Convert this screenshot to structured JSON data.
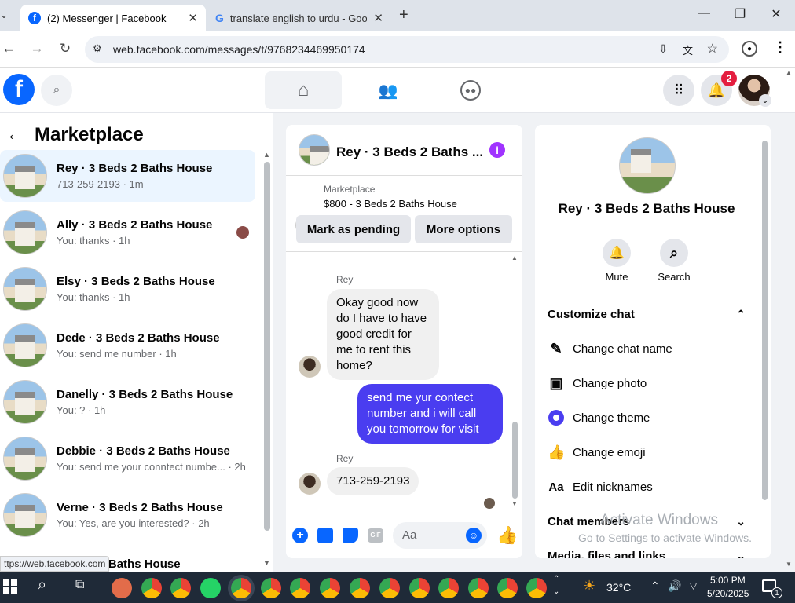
{
  "browser": {
    "tabs": [
      {
        "title": "(2) Messenger | Facebook"
      },
      {
        "title": "translate english to urdu - Goo"
      }
    ],
    "url": "web.facebook.com/messages/t/9768234469950174",
    "status_url": "ttps://web.facebook.com"
  },
  "fb": {
    "notifications_count": "2"
  },
  "left": {
    "title": "Marketplace",
    "conversations": [
      {
        "name": "Rey · 3 Beds 2 Baths House",
        "sub": "713-259-2193 · 1m"
      },
      {
        "name": "Ally · 3 Beds 2 Baths House",
        "sub": "You: thanks · 1h"
      },
      {
        "name": "Elsy · 3 Beds 2 Baths House",
        "sub": "You: thanks · 1h"
      },
      {
        "name": "Dede · 3 Beds 2 Baths House",
        "sub": "You: send me number · 1h"
      },
      {
        "name": "Danelly · 3 Beds 2 Baths House",
        "sub": "You: ? · 1h"
      },
      {
        "name": "Debbie · 3 Beds 2 Baths House",
        "sub": "You: send me your conntect numbe... · 2h"
      },
      {
        "name": "Verne · 3 Beds 2 Baths House",
        "sub": "You: Yes, are you interested? · 2h"
      },
      {
        "name": "3 Beds 2 Baths House",
        "sub": ""
      }
    ]
  },
  "chat": {
    "title": "Rey · 3 Beds 2 Baths ...",
    "listing_label": "Marketplace",
    "listing_title": "$800 - 3 Beds 2 Baths House",
    "mark_pending": "Mark as pending",
    "more_options": "More options",
    "sender1": "Rey",
    "msg1": "Okay good now do I have to have good credit for me to rent this home?",
    "msg_me": "send me yur contect number and i will call you tomorrow for visit",
    "sender2": "Rey",
    "msg2": "713-259-2193",
    "composer_placeholder": "Aa"
  },
  "panel": {
    "name": "Rey · 3 Beds 2 Baths House",
    "mute": "Mute",
    "search": "Search",
    "customize": "Customize chat",
    "options": [
      {
        "label": "Change chat name",
        "icon": "pencil-icon"
      },
      {
        "label": "Change photo",
        "icon": "photo-icon"
      },
      {
        "label": "Change theme",
        "icon": "theme-icon"
      },
      {
        "label": "Change emoji",
        "icon": "thumbs-up-icon"
      },
      {
        "label": "Edit nicknames",
        "icon": "aa-icon"
      }
    ],
    "members": "Chat members",
    "media": "Media, files and links"
  },
  "watermark": {
    "line1": "Activate Windows",
    "line2": "Go to Settings to activate Windows."
  },
  "taskbar": {
    "temp": "32°C",
    "time": "5:00 PM",
    "date": "5/20/2025",
    "notif": "1"
  },
  "colors": {
    "fb_blue": "#0866ff",
    "my_bubble": "#4a3df0",
    "purple": "#a033ff"
  }
}
